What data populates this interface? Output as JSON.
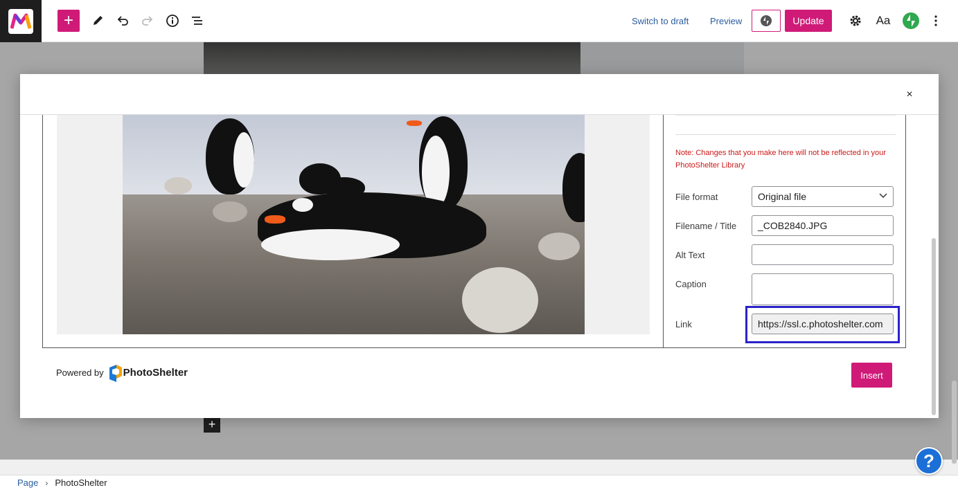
{
  "topbar": {
    "switch_to_draft": "Switch to draft",
    "preview": "Preview",
    "update": "Update",
    "typography_label": "Aa",
    "add_block": "+"
  },
  "modal": {
    "close": "×",
    "note": "Note: Changes that you make here will not be reflected in your PhotoShelter Library",
    "fields": {
      "file_format": {
        "label": "File format",
        "value": "Original file"
      },
      "filename": {
        "label": "Filename / Title",
        "value": "_COB2840.JPG"
      },
      "alt_text": {
        "label": "Alt Text",
        "value": ""
      },
      "caption": {
        "label": "Caption",
        "value": ""
      },
      "link": {
        "label": "Link",
        "value": "https://ssl.c.photoshelter.com"
      }
    },
    "footer": {
      "powered_by": "Powered by",
      "brand": "PhotoShelter",
      "insert": "Insert"
    }
  },
  "breadcrumb": {
    "items": [
      "Page",
      "PhotoShelter"
    ],
    "separator": "›"
  },
  "help": "?",
  "colors": {
    "accent": "#d01a78",
    "link": "#2a5c9e",
    "note": "#cc1818",
    "highlight": "#2b22c9",
    "help": "#1c6fd6"
  }
}
